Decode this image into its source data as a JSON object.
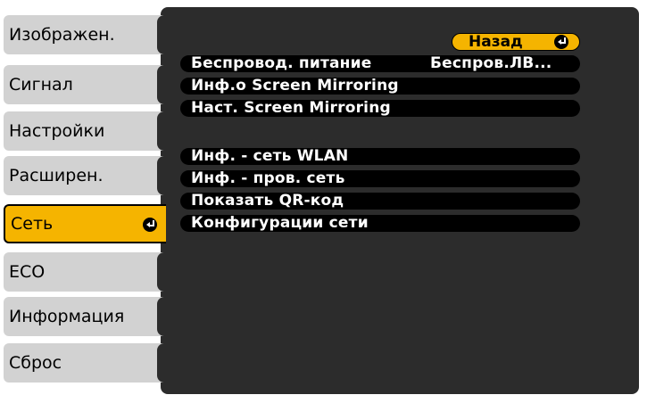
{
  "sidebar": {
    "tabs": [
      {
        "label": "Изображен."
      },
      {
        "label": "Сигнал"
      },
      {
        "label": "Настройки"
      },
      {
        "label": "Расширен."
      },
      {
        "label": "Сеть"
      },
      {
        "label": "ECO"
      },
      {
        "label": "Информация"
      },
      {
        "label": "Сброс"
      }
    ]
  },
  "main": {
    "back_label": "Назад",
    "rows": [
      {
        "label": "Беспровод. питание",
        "value": "Беспров.ЛВ..."
      },
      {
        "label": "Инф.о Screen Mirroring"
      },
      {
        "label": "Наст. Screen Mirroring"
      },
      {
        "label": "Инф. - сеть WLAN"
      },
      {
        "label": "Инф. - пров. сеть"
      },
      {
        "label": "Показать QR-код"
      },
      {
        "label": "Конфигурации сети"
      }
    ]
  },
  "colors": {
    "panel": "#2c2c2c",
    "tab": "#d2d2d2",
    "accent": "#f5b400",
    "row": "#000000",
    "row_text": "#ffffff"
  }
}
